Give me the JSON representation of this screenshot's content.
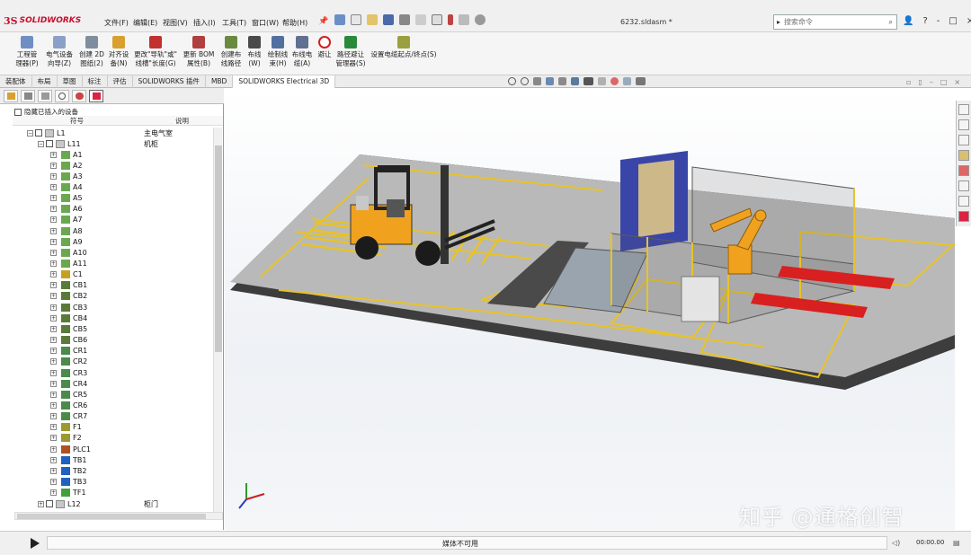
{
  "app": {
    "logo_ds": "3S",
    "logo_text": "SOLIDWORKS",
    "doc_title": "6232.sldasm *"
  },
  "menu": [
    "文件(F)",
    "编辑(E)",
    "视图(V)",
    "插入(I)",
    "工具(T)",
    "窗口(W)",
    "帮助(H)"
  ],
  "search": {
    "placeholder": "搜索命令"
  },
  "window_buttons": [
    "?",
    "-",
    "□",
    "×"
  ],
  "commands": [
    {
      "label": "工程管\n理器(P)",
      "icon": "project-manager-icon"
    },
    {
      "label": "电气设备\n向导(Z)",
      "icon": "wizard-icon"
    },
    {
      "label": "创建 2D\n图纸(2)",
      "icon": "drawing-icon"
    },
    {
      "label": "对齐设\n备(N)",
      "icon": "align-icon"
    },
    {
      "label": "更改\"导轨\"或\"\n线槽\"长度(G)",
      "icon": "rail-length-icon"
    },
    {
      "label": "更新 BOM\n属性(B)",
      "icon": "bom-icon"
    },
    {
      "label": "创建布\n线路径",
      "icon": "route-path-icon"
    },
    {
      "label": "布线\n(W)",
      "icon": "route-icon"
    },
    {
      "label": "绘制线\n束(H)",
      "icon": "harness-icon"
    },
    {
      "label": "布线电\n缆(A)",
      "icon": "cable-icon"
    },
    {
      "label": "避让",
      "icon": "avoid-icon"
    },
    {
      "label": "路径避让\n管理器(S)",
      "icon": "avoid-manager-icon"
    },
    {
      "label": "设置电缆起点/终点(S)",
      "icon": "cable-endpoint-icon"
    }
  ],
  "tabs": [
    "装配体",
    "布局",
    "草图",
    "标注",
    "评估",
    "SOLIDWORKS 插件",
    "MBD",
    "SOLIDWORKS Electrical 3D"
  ],
  "active_tab": "SOLIDWORKS Electrical 3D",
  "panel": {
    "hide_inserted": "隐藏已插入的设备",
    "col_symbol": "符号",
    "col_desc": "说明",
    "root": {
      "name": "L1",
      "desc": "主电气室"
    },
    "cabinet": {
      "name": "L11",
      "desc": "机柜"
    },
    "items": [
      "A1",
      "A2",
      "A3",
      "A4",
      "A5",
      "A6",
      "A7",
      "A8",
      "A9",
      "A10",
      "A11",
      "C1",
      "CB1",
      "CB2",
      "CB3",
      "CB4",
      "CB5",
      "CB6",
      "CR1",
      "CR2",
      "CR3",
      "CR4",
      "CR5",
      "CR6",
      "CR7",
      "F1",
      "F2",
      "PLC1",
      "TB1",
      "TB2",
      "TB3",
      "TF1"
    ],
    "last": {
      "name": "L12",
      "desc": "柜门"
    }
  },
  "media": {
    "status": "媒体不可用",
    "time": "00:00.00"
  },
  "watermark": "知乎 @通格创智",
  "colors": {
    "floor": "#b9b9b9",
    "floor_edge": "#3c3c3c",
    "lines": "#e8c327",
    "forklift": "#f0a21f",
    "robot": "#f0a21f",
    "conveyor_red": "#d82020",
    "fence": "#5b5b5b",
    "tower": "#3a45a8"
  }
}
